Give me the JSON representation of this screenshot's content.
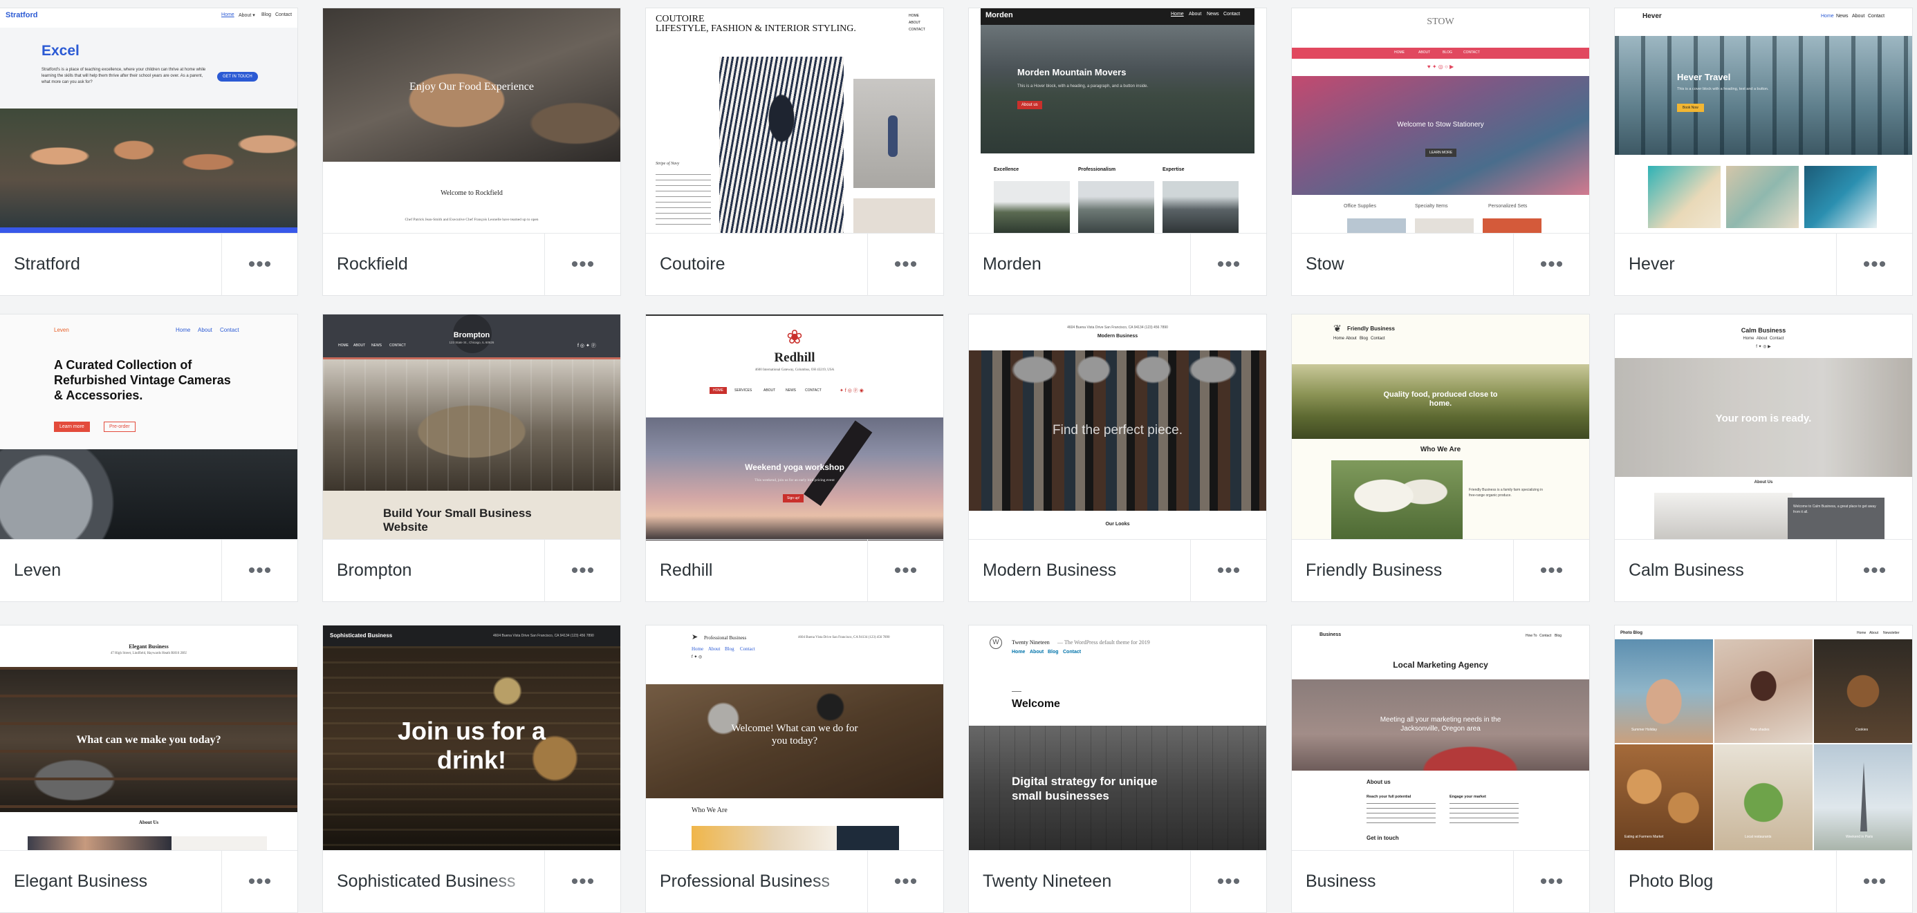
{
  "themes": [
    {
      "name": "Stratford",
      "logo": "Stratford",
      "nav": [
        "Home",
        "About ▾",
        "Blog",
        "Contact"
      ],
      "heading": "Excel",
      "body": "Stratford's is a place of teaching excellence, where your children can thrive at home while learning the skills that will help them thrive after their school years are over. As a parent, what more can you ask for?",
      "button": "GET IN TOUCH"
    },
    {
      "name": "Rockfield",
      "hero": "Enjoy Our Food Experience",
      "welcome": "Welcome to Rockfield",
      "body": "Chef Patrick Jean-Smith and Executive Chef François Leonelle have teamed up to open"
    },
    {
      "name": "Coutoire",
      "logo1": "COUTOIRE",
      "logo2": "LIFESTYLE, FASHION & INTERIOR STYLING.",
      "nav": [
        "HOME",
        "ABOUT",
        "CONTACT"
      ],
      "caption": "Stripe of Navy"
    },
    {
      "name": "Morden",
      "logo": "Morden",
      "nav": [
        "Home",
        "About",
        "News",
        "Contact"
      ],
      "hero": "Morden Mountain Movers",
      "body": "This is a Hover block, with a heading, a paragraph, and a button inside.",
      "button": "About us",
      "cols": [
        "Excellence",
        "Professionalism",
        "Expertise"
      ]
    },
    {
      "name": "Stow",
      "logo": "STOW",
      "nav": [
        "HOME",
        "ABOUT",
        "BLOG",
        "CONTACT"
      ],
      "hero": "Welcome to Stow Stationery",
      "button": "LEARN MORE",
      "cols": [
        "Office Supplies",
        "Specialty Items",
        "Personalized Sets"
      ]
    },
    {
      "name": "Hever",
      "logo": "Hever",
      "nav": [
        "Home",
        "News",
        "About",
        "Contact"
      ],
      "hero": "Hever Travel",
      "body": "This is a cover block with a heading, text and a button.",
      "button": "Book Now"
    },
    {
      "name": "Leven",
      "logo": "Leven",
      "nav": [
        "Home",
        "About",
        "Contact"
      ],
      "hero": "A Curated Collection of Refurbished Vintage Cameras & Accessories.",
      "button1": "Learn more",
      "button2": "Pre-order"
    },
    {
      "name": "Brompton",
      "logo": "Brompton",
      "sub": "123 State St., Chicago, IL 60626",
      "nav": [
        "HOME",
        "ABOUT",
        "NEWS",
        "CONTACT"
      ],
      "hero": "Build Your Small Business Website"
    },
    {
      "name": "Redhill",
      "logo": "Redhill",
      "address": "4600 International Gateway, Columbus, OH 43219, USA",
      "nav": [
        "HOME",
        "SERVICES",
        "ABOUT",
        "NEWS",
        "CONTACT"
      ],
      "hero": "Weekend yoga workshop",
      "body": "This weekend, join us for an early bird pricing event",
      "button": "Sign up!"
    },
    {
      "name": "Modern Business",
      "address": "4604 Buena Vista Drive San Francisco, CA 94134 (123) 456 7890",
      "logo": "Modern Business",
      "hero": "Find the perfect piece.",
      "section": "Our Looks"
    },
    {
      "name": "Friendly Business",
      "logo": "Friendly Business",
      "nav": [
        "Home",
        "About",
        "Blog",
        "Contact"
      ],
      "hero": "Quality food, produced close to home.",
      "section": "Who We Are",
      "aside": "Friendly Business is a family farm specializing in free-range organic produce."
    },
    {
      "name": "Calm Business",
      "logo": "Calm Business",
      "nav": [
        "Home",
        "About",
        "Contact"
      ],
      "hero": "Your room is ready.",
      "section": "About Us",
      "card": "Welcome to Calm Business, a great place to get away from it all."
    },
    {
      "name": "Elegant Business",
      "logo": "Elegant Business",
      "sub": "47 High Street, Lindfield, Haywards Heath RH16 2HU",
      "hero": "What can we make you today?",
      "section": "About Us"
    },
    {
      "name": "Sophisticated Business",
      "logo": "Sophisticated Business",
      "address": "4604 Buena Vista Drive San Francisco, CA 94134 (123) 456 7890",
      "hero": "Join us for a drink!"
    },
    {
      "name": "Professional Business",
      "logo": "Professional Business",
      "address": "4604 Buena Vista Drive San Francisco, CA 94134 (123) 456 7890",
      "nav": [
        "Home",
        "About",
        "Blog",
        "Contact"
      ],
      "hero": "Welcome! What can we do for you today?",
      "section": "Who We Are"
    },
    {
      "name": "Twenty Nineteen",
      "logo": "Twenty Nineteen",
      "tagline": "— The WordPress default theme for 2019",
      "nav": [
        "Home",
        "About",
        "Blog",
        "Contact"
      ],
      "heading": "Welcome",
      "hero": "Digital strategy for unique small businesses"
    },
    {
      "name": "Business",
      "logo": "Business",
      "nav": [
        "How To",
        "Contact",
        "Blog"
      ],
      "heading": "Local Marketing Agency",
      "hero": "Meeting all your marketing needs in the Jacksonville, Oregon area",
      "section": "About us",
      "col1": "Reach your full potential",
      "col2": "Engage your market",
      "footer": "Get in touch"
    },
    {
      "name": "Photo Blog",
      "logo": "Photo Blog",
      "nav": [
        "Home",
        "About",
        "Newsletter"
      ],
      "captions": [
        "Summer Holiday",
        "New shades",
        "Cookies",
        "Eating at Farmers Market",
        "Local restaurants",
        "Weekend in Paris"
      ]
    }
  ],
  "more_icon": "ellipsis-icon",
  "colors": {
    "page_bg": "#f3f4f5",
    "card_border": "#e3e5e7",
    "title_text": "#2c3338",
    "accent_blue": "#3858e9"
  }
}
